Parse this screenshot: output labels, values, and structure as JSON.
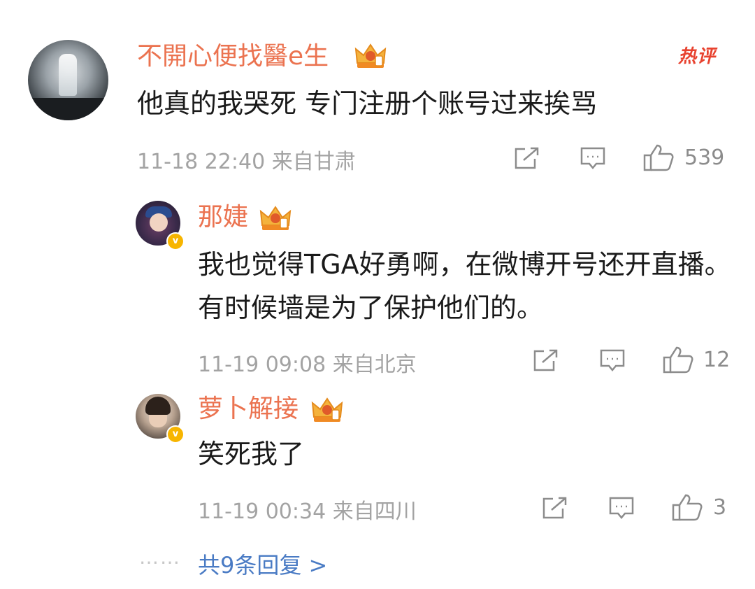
{
  "comment": {
    "username": "不開心便找醫e生",
    "hot_label": "热评",
    "text": "他真的我哭死 专门注册个账号过来挨骂",
    "time": "11-18 22:40 来自甘肃",
    "likes": "539"
  },
  "replies": [
    {
      "username": "那婕",
      "verified_badge": "v",
      "text": "我也觉得TGA好勇啊，在微博开号还开直播。有时候墙是为了保护他们的。",
      "time": "11-19 09:08 来自北京",
      "likes": "12"
    },
    {
      "username": "萝卜解接",
      "verified_badge": "v",
      "text": "笑死我了",
      "time": "11-19 00:34 来自四川",
      "likes": "3"
    }
  ],
  "more_replies": {
    "dots": "……",
    "label": "共9条回复 >"
  },
  "icons": {
    "share": "share-icon",
    "comment": "comment-icon",
    "like": "thumbs-up-icon",
    "crown": "crown-badge-icon"
  },
  "colors": {
    "username": "#eb7350",
    "hot": "#e8422f",
    "link": "#4a7bc4",
    "meta": "#a3a3a3",
    "verified": "#f7b500"
  }
}
